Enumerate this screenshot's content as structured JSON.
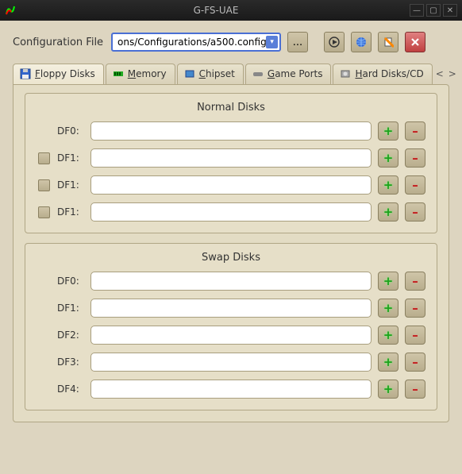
{
  "window": {
    "title": "G-FS-UAE"
  },
  "config": {
    "label": "Configuration File",
    "value": "ons/Configurations/a500.config",
    "browse": "...",
    "play_tip": "Run",
    "globe_tip": "Online",
    "edit_tip": "Edit",
    "close_tip": "Close"
  },
  "tabs": [
    {
      "label_pre": "",
      "mn": "F",
      "label_post": "loppy Disks"
    },
    {
      "label_pre": "",
      "mn": "M",
      "label_post": "emory"
    },
    {
      "label_pre": "",
      "mn": "C",
      "label_post": "hipset"
    },
    {
      "label_pre": "",
      "mn": "G",
      "label_post": "ame Ports"
    },
    {
      "label_pre": "",
      "mn": "H",
      "label_post": "ard Disks/CD"
    }
  ],
  "normal": {
    "title": "Normal Disks",
    "rows": [
      {
        "label": "DF0:",
        "value": "",
        "chk": false
      },
      {
        "label": "DF1:",
        "value": "",
        "chk": true
      },
      {
        "label": "DF1:",
        "value": "",
        "chk": true
      },
      {
        "label": "DF1:",
        "value": "",
        "chk": true
      }
    ]
  },
  "swap": {
    "title": "Swap Disks",
    "rows": [
      {
        "label": "DF0:",
        "value": ""
      },
      {
        "label": "DF1:",
        "value": ""
      },
      {
        "label": "DF2:",
        "value": ""
      },
      {
        "label": "DF3:",
        "value": ""
      },
      {
        "label": "DF4:",
        "value": ""
      }
    ]
  }
}
